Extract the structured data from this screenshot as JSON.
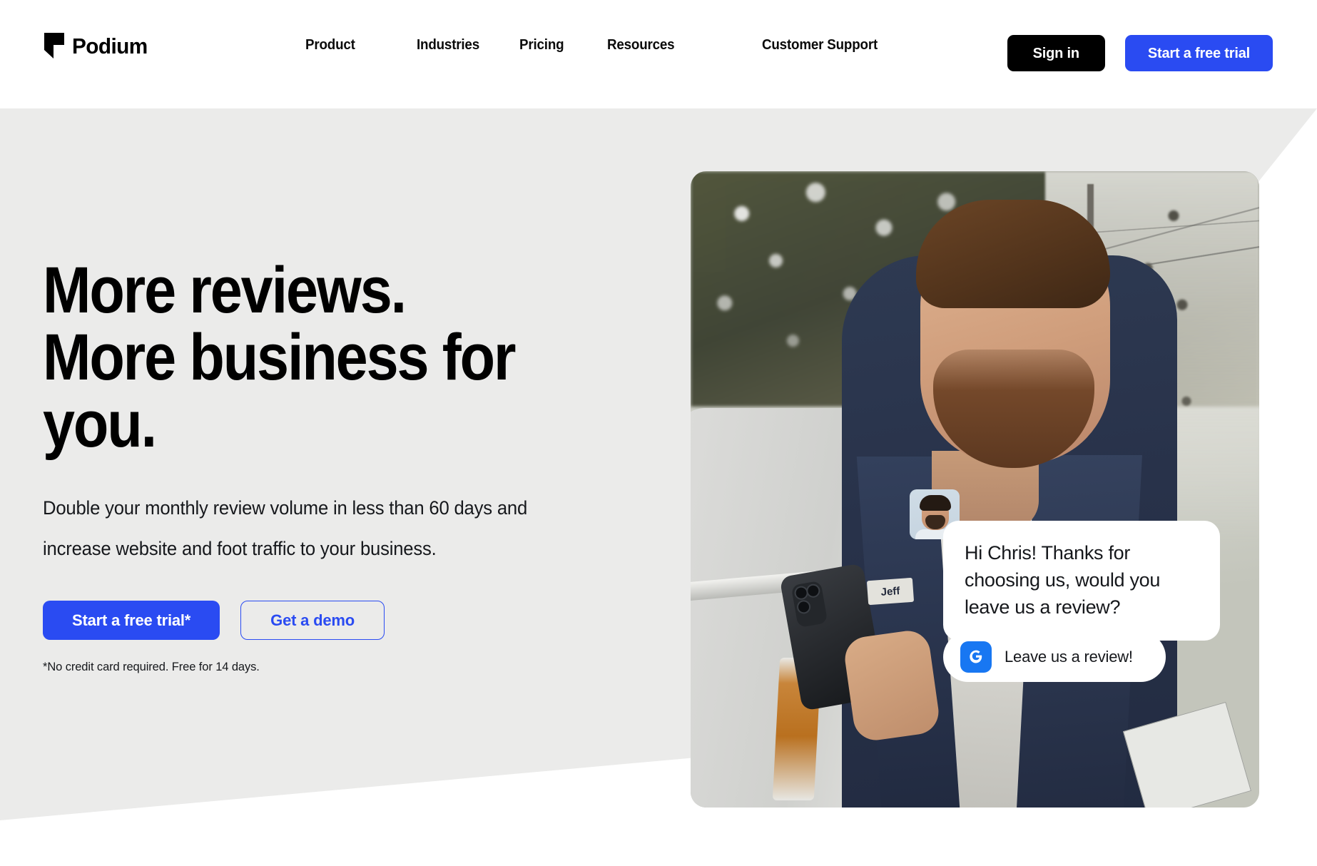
{
  "brand": {
    "name": "Podium",
    "logo_icon": "podium-flag-icon",
    "accent_blue": "#2a4bf2",
    "black": "#000000",
    "hero_bg": "#ebebea"
  },
  "header": {
    "nav_items": [
      {
        "label": "Product"
      },
      {
        "label": "Industries"
      },
      {
        "label": "Pricing"
      },
      {
        "label": "Resources"
      },
      {
        "label": "Customer Support"
      }
    ],
    "sign_in_label": "Sign in",
    "trial_label": "Start a free trial"
  },
  "hero": {
    "headline_line1": "More reviews.",
    "headline_line2": "More business for",
    "headline_line3": "you.",
    "subhead": "Double your monthly review volume in less than 60 days and increase website and foot traffic to your business.",
    "primary_cta": "Start a free trial*",
    "secondary_cta": "Get a demo",
    "disclaimer": "*No credit card required. Free for 14 days.",
    "photo_alt": "Technician in denim jacket looking at phone beside white work van",
    "badge_text": "Jeff"
  },
  "chat": {
    "avatar_icon": "customer-avatar",
    "message": "Hi Chris! Thanks for choosing us, would you leave us a review?",
    "reply_icon": "google-review-icon",
    "reply_label": "Leave us a review!",
    "reply_icon_color": "#1877f2"
  }
}
